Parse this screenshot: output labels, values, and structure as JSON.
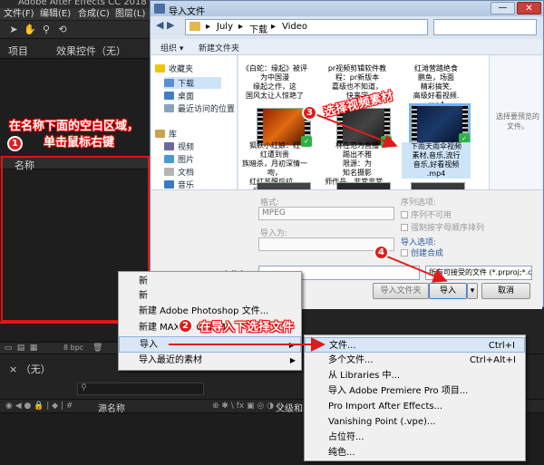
{
  "ae": {
    "title": "Adobe After Effects CC 2018",
    "menu": [
      "文件(F)",
      "编辑(E)",
      "合成(C)",
      "图层(L)"
    ],
    "panel_tabs": [
      "项目",
      "效果控件（无）"
    ],
    "name_column": "名称",
    "bpc": "8 bpc",
    "timeline_tab": "（无）",
    "timeline_column": "源名称",
    "timeline_right_col": "父级和"
  },
  "dialog": {
    "title": "导入文件",
    "breadcrumb": [
      "July",
      "下载",
      "Video"
    ],
    "commands": [
      "组织 ▾",
      "新建文件夹"
    ],
    "nav": {
      "favorites": "收藏夹",
      "downloads": "下载",
      "desktop": "桌面",
      "recent": "最近访问的位置",
      "library": "库",
      "video": "视频",
      "pictures": "图片",
      "docs": "文档",
      "music": "音乐"
    },
    "files": [
      {
        "caption": "《白蛇：缘起》被评为中国漫\n缘起之作，这\n国风太让人惊艳了"
      },
      {
        "caption": "pr视频剪辑软件教程：pr新版本\n嘉级也不知道，\n快来学"
      },
      {
        "caption": "红滩营踏绝食\n鹏鱼，场面\n精彩搞笑,\n高级好看视频.\nmp4"
      },
      {
        "caption": "狐妖小红娘：红\n红遭到贵\n族暗杀，月初深情一吻，\n红红苏醒后拉...\n红红苏醒后拉"
      },
      {
        "caption": "林在范为直播\n踢出不雅\n限源：为\n知名摄影\n师作品，非常非常..."
      },
      {
        "caption": "下雨天雨伞视频\n素材,音乐,流行\n音乐,好看视频\n.mp4"
      }
    ],
    "preview_hint": "选择要预览的文件。",
    "format_label": "格式:",
    "format_value": "MPEG",
    "import_as_label": "导入为:",
    "sequence_label": "序列选项:",
    "sequence_opt1": "序列不可用",
    "sequence_opt2": "强制按字母顺序排列",
    "import_options_label": "导入选项:",
    "create_comp": "创建合成",
    "filename_label": "文件名(N):",
    "filetype": "所有可接受的文件 (*.prproj;*.c",
    "btn_import_folder": "导入文件夹",
    "btn_import": "导入",
    "btn_cancel": "取消"
  },
  "context_menu": {
    "items": [
      {
        "label": "新"
      },
      {
        "label": "新"
      },
      {
        "label": "新建 Adobe Photoshop 文件..."
      },
      {
        "label": "新建 MAXON CINEMA"
      },
      {
        "label": "导入"
      },
      {
        "label": "导入最近的素材"
      }
    ]
  },
  "submenu": {
    "items": [
      {
        "label": "文件...",
        "shortcut": "Ctrl+I"
      },
      {
        "label": "多个文件...",
        "shortcut": "Ctrl+Alt+I"
      },
      {
        "label": "从 Libraries 中...",
        "shortcut": ""
      },
      {
        "label": "导入 Adobe Premiere Pro 项目...",
        "shortcut": ""
      },
      {
        "label": "Pro Import After Effects...",
        "shortcut": ""
      },
      {
        "label": "Vanishing Point (.vpe)...",
        "shortcut": ""
      },
      {
        "label": "占位符...",
        "shortcut": ""
      },
      {
        "label": "纯色...",
        "shortcut": ""
      }
    ]
  },
  "annotations": {
    "step1_text_line1": "在名称下面的空白区域，",
    "step1_text_line2": "单击鼠标右键",
    "step2_text": "在导入下选择文件",
    "step3_text": "选择视频素材",
    "badges": [
      "1",
      "2",
      "3",
      "4"
    ],
    "color": "#e01b1b"
  }
}
